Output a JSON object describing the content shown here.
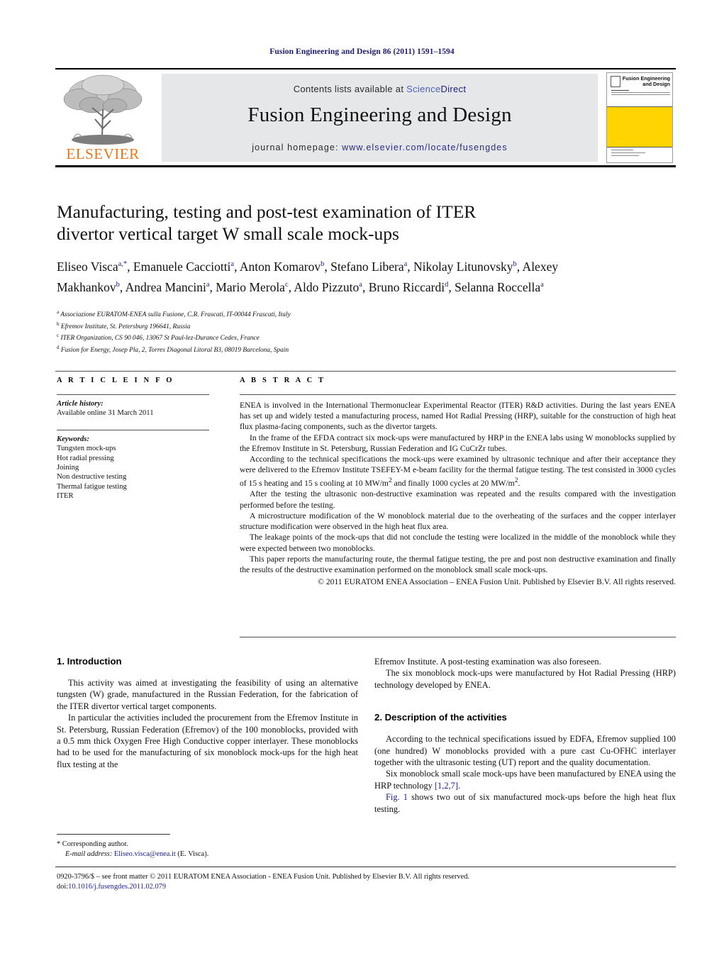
{
  "running_head": "Fusion Engineering and Design 86 (2011) 1591–1594",
  "masthead": {
    "elsevier_wordmark": "ELSEVIER",
    "contents_prefix": "Contents lists available at ",
    "sciencedirect_a": "Science",
    "sciencedirect_b": "Direct",
    "journal_title": "Fusion Engineering and Design",
    "homepage_label": "journal homepage: ",
    "homepage_url": "www.elsevier.com/locate/fusengdes",
    "cover_title_line1": "Fusion Engineering",
    "cover_title_line2": "and Design"
  },
  "article": {
    "title_line1": "Manufacturing, testing and post-test examination of ITER",
    "title_line2": "divertor vertical target W small scale mock-ups",
    "authors_html": "Eliseo Visca<sup>a,*</sup>, Emanuele Cacciotti<sup>a</sup>, Anton Komarov<sup>b</sup>, Stefano Libera<sup>a</sup>, Nikolay Litunovsky<sup>b</sup>, Alexey Makhankov<sup>b</sup>, Andrea Mancini<sup>a</sup>, Mario Merola<sup>c</sup>, Aldo Pizzuto<sup>a</sup>, Bruno Riccardi<sup>d</sup>, Selanna Roccella<sup>a</sup>",
    "affiliations": [
      {
        "mark": "a",
        "text": "Associazione EURATOM-ENEA sulla Fusione, C.R. Frascati, IT-00044 Frascati, Italy"
      },
      {
        "mark": "b",
        "text": "Efremov Institute, St. Petersburg 196641, Russia"
      },
      {
        "mark": "c",
        "text": "ITER Organization, CS 90 046, 13067 St Paul-lez-Durance Cedex, France"
      },
      {
        "mark": "d",
        "text": "Fusion for Energy, Josep Pla, 2, Torres Diagonal Litoral B3, 08019 Barcelona, Spain"
      }
    ]
  },
  "article_info": {
    "heading": "A R T I C L E   I N F O",
    "history_label": "Article history:",
    "history_value": "Available online 31 March 2011",
    "keywords_label": "Keywords:",
    "keywords": [
      "Tungsten mock-ups",
      "Hot radial pressing",
      "Joining",
      "Non destructive testing",
      "Thermal fatigue testing",
      "ITER"
    ]
  },
  "abstract": {
    "heading": "A B S T R A C T",
    "paragraphs": [
      "ENEA is involved in the International Thermonuclear Experimental Reactor (ITER) R&D activities. During the last years ENEA has set up and widely tested a manufacturing process, named Hot Radial Pressing (HRP), suitable for the construction of high heat flux plasma-facing components, such as the divertor targets.",
      "In the frame of the EFDA contract six mock-ups were manufactured by HRP in the ENEA labs using W monoblocks supplied by the Efremov Institute in St. Petersburg, Russian Federation and IG CuCrZr tubes.",
      "According to the technical specifications the mock-ups were examined by ultrasonic technique and after their acceptance they were delivered to the Efremov Institute TSEFEY-M e-beam facility for the thermal fatigue testing. The test consisted in 3000 cycles of 15 s heating and 15 s cooling at 10 MW/m2 and finally 1000 cycles at 20 MW/m2.",
      "After the testing the ultrasonic non-destructive examination was repeated and the results compared with the investigation performed before the testing.",
      "A microstructure modification of the W monoblock material due to the overheating of the surfaces and the copper interlayer structure modification were observed in the high heat flux area.",
      "The leakage points of the mock-ups that did not conclude the testing were localized in the middle of the monoblock while they were expected between two monoblocks.",
      "This paper reports the manufacturing route, the thermal fatigue testing, the pre and post non destructive examination and finally the results of the destructive examination performed on the monoblock small scale mock-ups."
    ],
    "copyright": "© 2011 EURATOM ENEA Association – ENEA Fusion Unit. Published by Elsevier B.V. All rights reserved."
  },
  "body": {
    "left": {
      "section1_heading": "1.  Introduction",
      "p1": "This activity was aimed at investigating the feasibility of using an alternative tungsten (W) grade, manufactured in the Russian Federation, for the fabrication of the ITER divertor vertical target components.",
      "p2": "In particular the activities included the procurement from the Efremov Institute in St. Petersburg, Russian Federation (Efremov) of the 100 monoblocks, provided with a 0.5 mm thick Oxygen Free High Conductive copper interlayer. These monoblocks had to be used for the manufacturing of six monoblock mock-ups for the high heat flux testing at the"
    },
    "right": {
      "p1": "Efremov Institute. A post-testing examination was also foreseen.",
      "p2": "The six monoblock mock-ups were manufactured by Hot Radial Pressing (HRP) technology developed by ENEA.",
      "section2_heading": "2.  Description of the activities",
      "p3": "According to the technical specifications issued by EDFA, Efremov supplied 100 (one hundred) W monoblocks provided with a pure cast Cu-OFHC interlayer together with the ultrasonic testing (UT) report and the quality documentation.",
      "p4_before": "Six monoblock small scale mock-ups have been manufactured by ENEA using the HRP technology ",
      "p4_ref": "[1,2,7]",
      "p4_after": ".",
      "p5_ref": "Fig. 1",
      "p5_after": " shows two out of six manufactured mock-ups before the high heat flux testing."
    }
  },
  "footnote": {
    "corresponding": "* Corresponding author.",
    "email_label": "E-mail address: ",
    "email": "Eliseo.visca@enea.it",
    "email_suffix": " (E. Visca)."
  },
  "bottom": {
    "copyright": "0920-3796/$ – see front matter © 2011 EURATOM ENEA Association - ENEA Fusion Unit. Published by Elsevier B.V. All rights reserved.",
    "doi_prefix": "doi:",
    "doi": "10.1016/j.fusengdes.2011.02.079"
  },
  "colors": {
    "navy": "#1d1d8c",
    "elsevier_orange": "#e8761a",
    "cover_yellow": "#ffd400",
    "band_grey": "#e6e7e8"
  }
}
